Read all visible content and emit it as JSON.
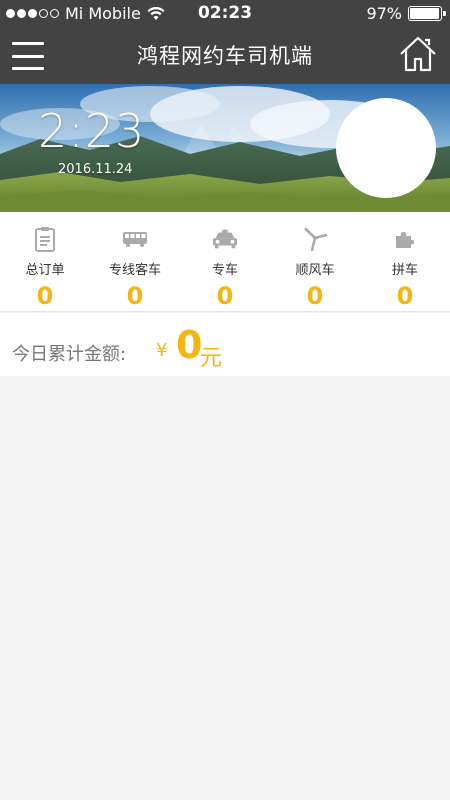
{
  "status_bar": {
    "carrier": "Mi Mobile",
    "time": "02:23",
    "battery": "97%",
    "battery_level": 0.97
  },
  "nav": {
    "title": "鸿程网约车司机端",
    "menu_icon": "hamburger-menu-icon",
    "home_icon": "home-icon"
  },
  "banner": {
    "clock": "2:23",
    "date": "2016.11.24"
  },
  "stats": [
    {
      "icon": "order-list-icon",
      "label": "总订单",
      "value": "0"
    },
    {
      "icon": "bus-icon",
      "label": "专线客车",
      "value": "0"
    },
    {
      "icon": "taxi-icon",
      "label": "专车",
      "value": "0"
    },
    {
      "icon": "windmill-icon",
      "label": "顺风车",
      "value": "0"
    },
    {
      "icon": "puzzle-icon",
      "label": "拼车",
      "value": "0"
    }
  ],
  "today": {
    "label": "今日累计金额:",
    "currency": "¥",
    "amount": "0",
    "unit": "元"
  },
  "colors": {
    "header_bg": "#434343",
    "accent": "#f5b512",
    "page_bg": "#f3f3f3"
  }
}
